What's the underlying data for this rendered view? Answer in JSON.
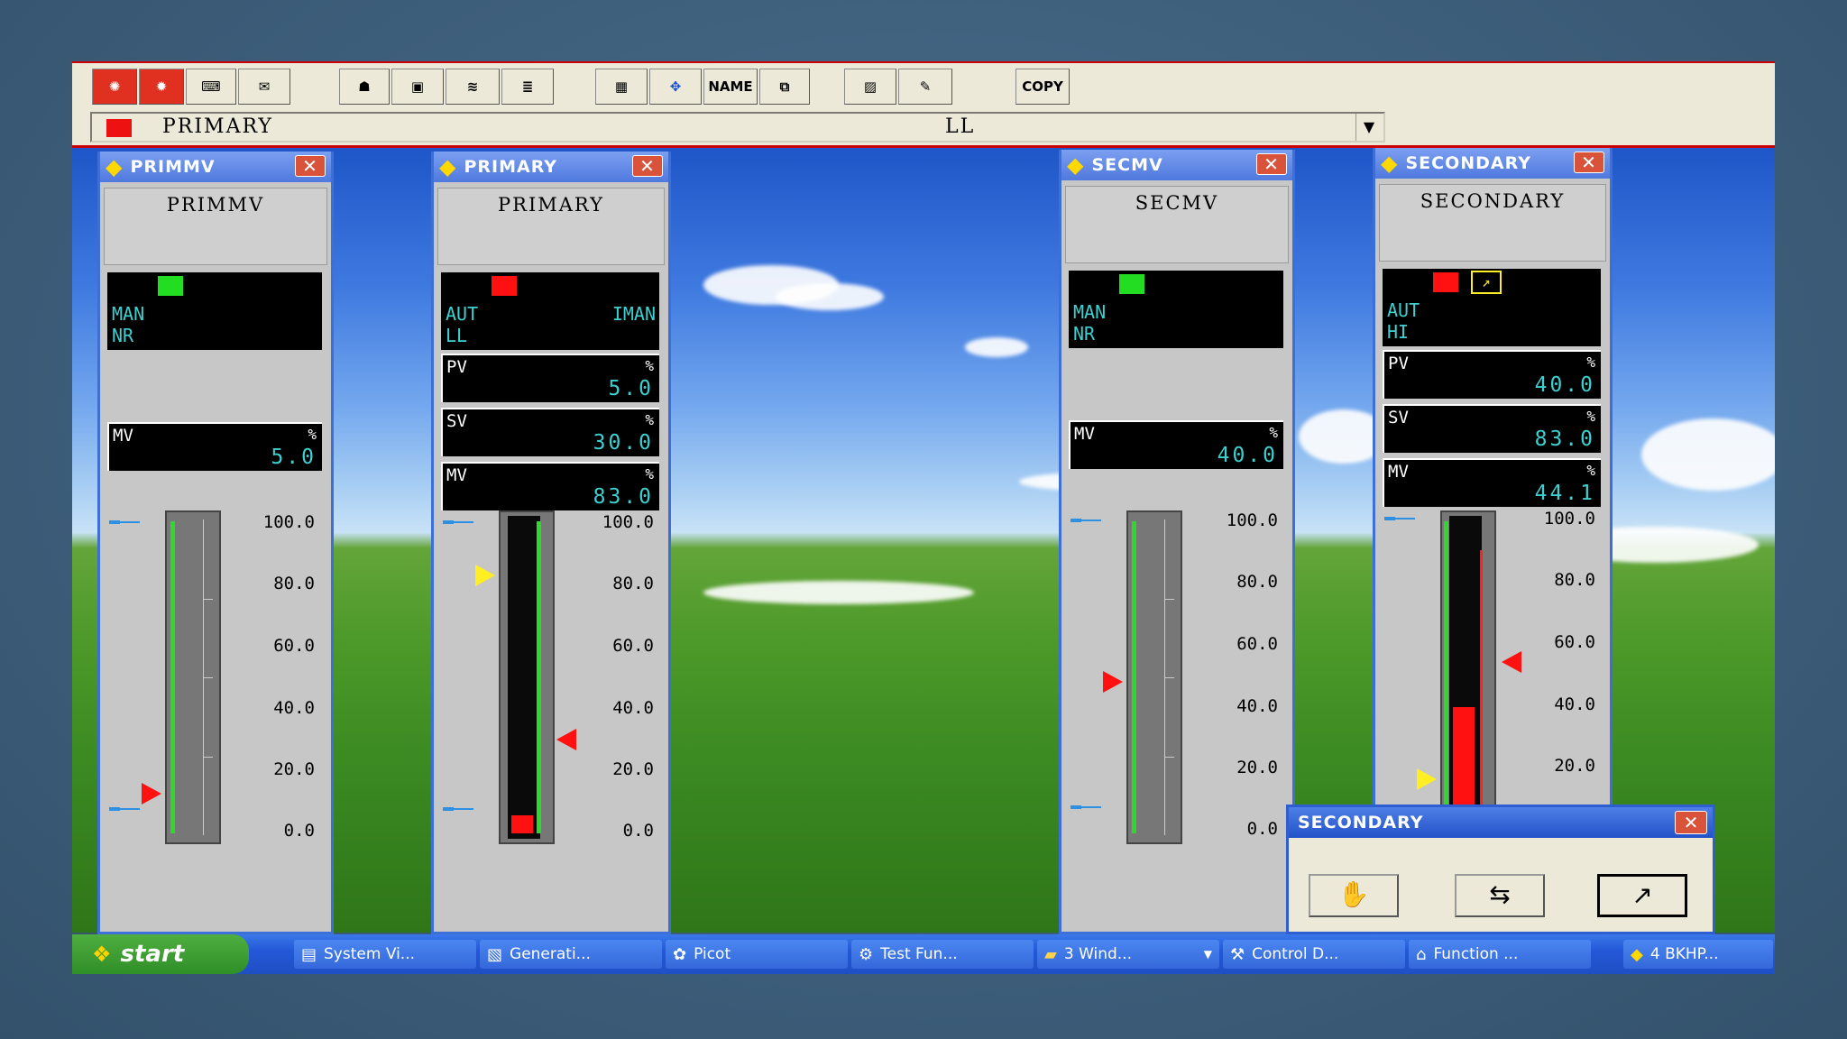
{
  "toolbar": {
    "name_label": "NAME",
    "copy_label": "COPY",
    "tag_name": "PRIMARY",
    "tag_alarm": "LL"
  },
  "colors": {
    "lamp_green": "#22dd22",
    "lamp_red": "#ff1111",
    "value_text": "#3ed0d0",
    "pointer_red": "#ff1111",
    "pointer_yellow": "#ffee22"
  },
  "scale_labels": [
    "100.0",
    "80.0",
    "60.0",
    "40.0",
    "20.0",
    "0.0"
  ],
  "faceplates": [
    {
      "title": "PRIMMV",
      "name": "PRIMMV",
      "mode1": "MAN",
      "mode2": "NR",
      "mode3": "",
      "mv_label": "MV",
      "mv_unit": "%",
      "mv_value": "5.0"
    },
    {
      "title": "PRIMARY",
      "name": "PRIMARY",
      "mode1": "AUT",
      "mode2": "LL",
      "mode3": "IMAN",
      "pv_label": "PV",
      "pv_unit": "%",
      "pv_value": "5.0",
      "sv_label": "SV",
      "sv_unit": "%",
      "sv_value": "30.0",
      "mv_label": "MV",
      "mv_unit": "%",
      "mv_value": "83.0"
    },
    {
      "title": "SECMV",
      "name": "SECMV",
      "mode1": "MAN",
      "mode2": "NR",
      "mode3": "",
      "mv_label": "MV",
      "mv_unit": "%",
      "mv_value": "40.0"
    },
    {
      "title": "SECONDARY",
      "name": "SECONDARY",
      "mode1": "AUT",
      "mode2": "HI",
      "mode3": "",
      "pv_label": "PV",
      "pv_unit": "%",
      "pv_value": "40.0",
      "sv_label": "SV",
      "sv_unit": "%",
      "sv_value": "83.0",
      "mv_label": "MV",
      "mv_unit": "%",
      "mv_value": "44.1"
    }
  ],
  "popup": {
    "title": "SECONDARY"
  },
  "taskbar": {
    "start": "start",
    "items": [
      "System Vi...",
      "Generati...",
      "Picot",
      "Test Fun...",
      "3 Wind...",
      "Control D...",
      "Function ...",
      "4 BKHP..."
    ]
  }
}
